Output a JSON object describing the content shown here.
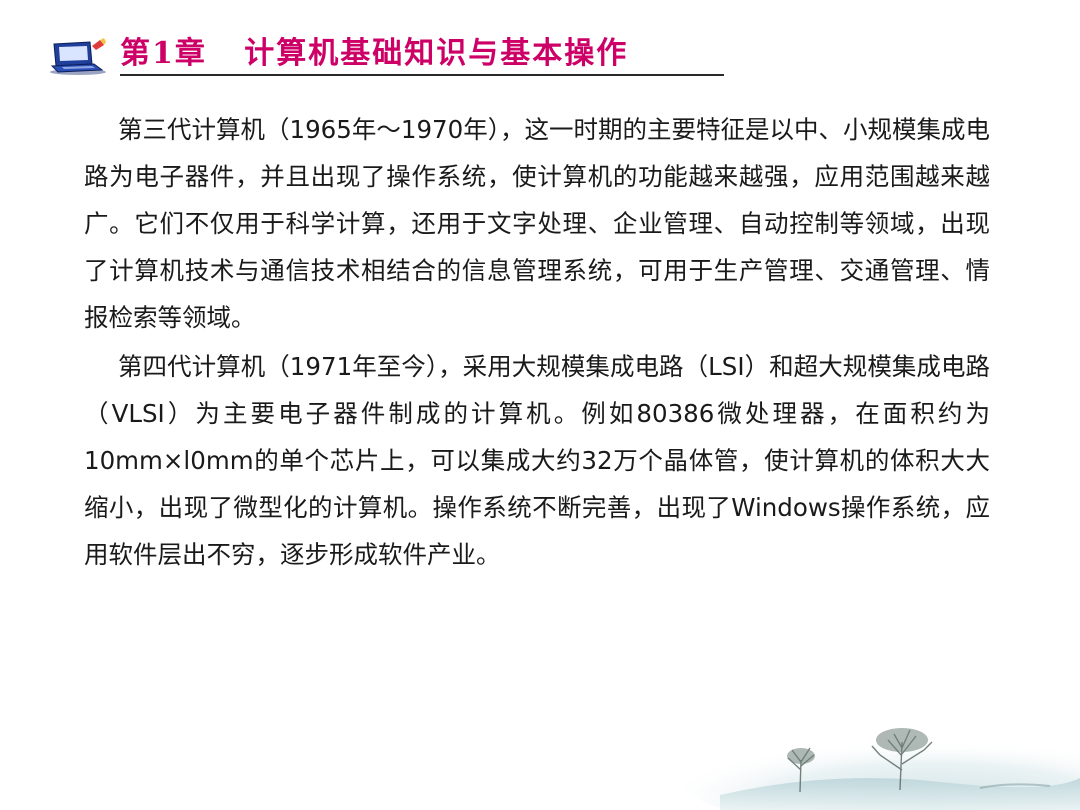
{
  "header": {
    "icon": "laptop-icon",
    "title": "第1章   计算机基础知识与基本操作"
  },
  "paragraphs": [
    "第三代计算机（1965年～1970年），这一时期的主要特征是以中、小规模集成电路为电子器件，并且出现了操作系统，使计算机的功能越来越强，应用范围越来越广。它们不仅用于科学计算，还用于文字处理、企业管理、自动控制等领域，出现了计算机技术与通信技术相结合的信息管理系统，可用于生产管理、交通管理、情报检索等领域。",
    "第四代计算机（1971年至今），采用大规模集成电路（LSI）和超大规模集成电路（VLSI）为主要电子器件制成的计算机。例如80386微处理器，在面积约为10mm×l0mm的单个芯片上，可以集成大约32万个晶体管，使计算机的体积大大缩小，出现了微型化的计算机。操作系统不断完善，出现了Windows操作系统，应用软件层出不穷，逐步形成软件产业。"
  ],
  "decoration": {
    "scenery": "winter-tree-landscape"
  },
  "colors": {
    "title": "#cc0066",
    "text": "#1a1a1a",
    "icon_body": "#1f3f9a"
  }
}
